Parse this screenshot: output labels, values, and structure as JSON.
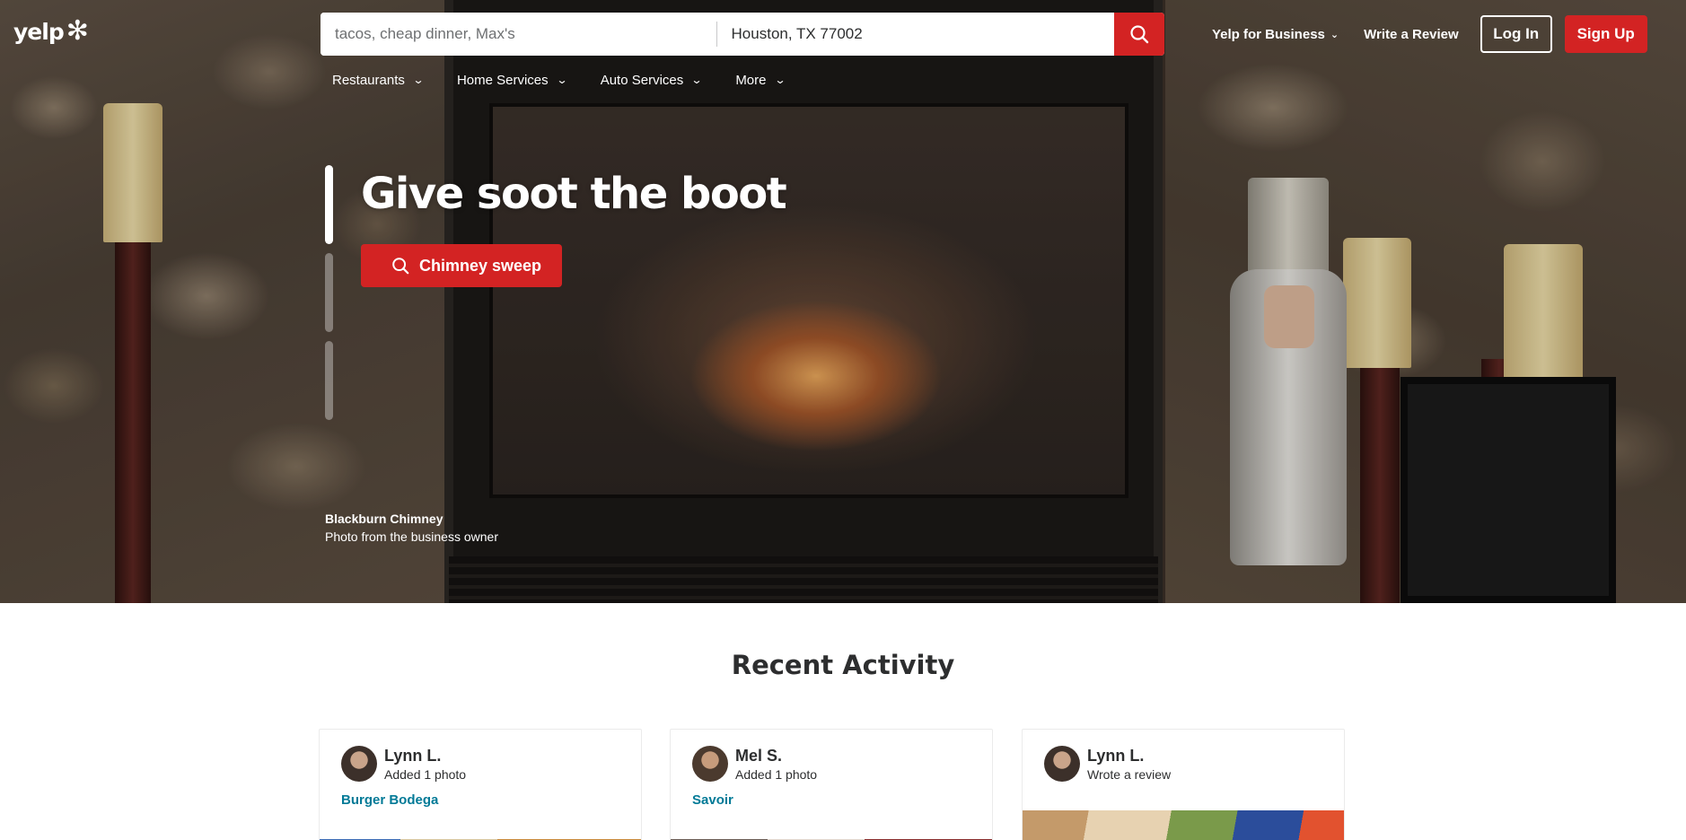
{
  "brand": {
    "logo_text": "yelp",
    "accent": "#d32323"
  },
  "search": {
    "find_placeholder": "tacos, cheap dinner, Max's",
    "near_value": "Houston, TX 77002"
  },
  "topnav": {
    "for_business": "Yelp for Business",
    "write_review": "Write a Review",
    "login": "Log In",
    "signup": "Sign Up"
  },
  "categories": [
    {
      "label": "Restaurants"
    },
    {
      "label": "Home Services"
    },
    {
      "label": "Auto Services"
    },
    {
      "label": "More"
    }
  ],
  "hero": {
    "title": "Give soot the boot",
    "cta_label": "Chimney sweep",
    "credit_business": "Blackburn Chimney",
    "credit_note": "Photo from the business owner",
    "slides_total": 3,
    "active_slide": 1
  },
  "recent": {
    "title": "Recent Activity",
    "cards": [
      {
        "user": "Lynn L.",
        "action": "Added 1 photo",
        "business": "Burger Bodega"
      },
      {
        "user": "Mel S.",
        "action": "Added 1 photo",
        "business": "Savoir"
      },
      {
        "user": "Lynn L.",
        "action": "Wrote a review",
        "business": ""
      }
    ]
  }
}
